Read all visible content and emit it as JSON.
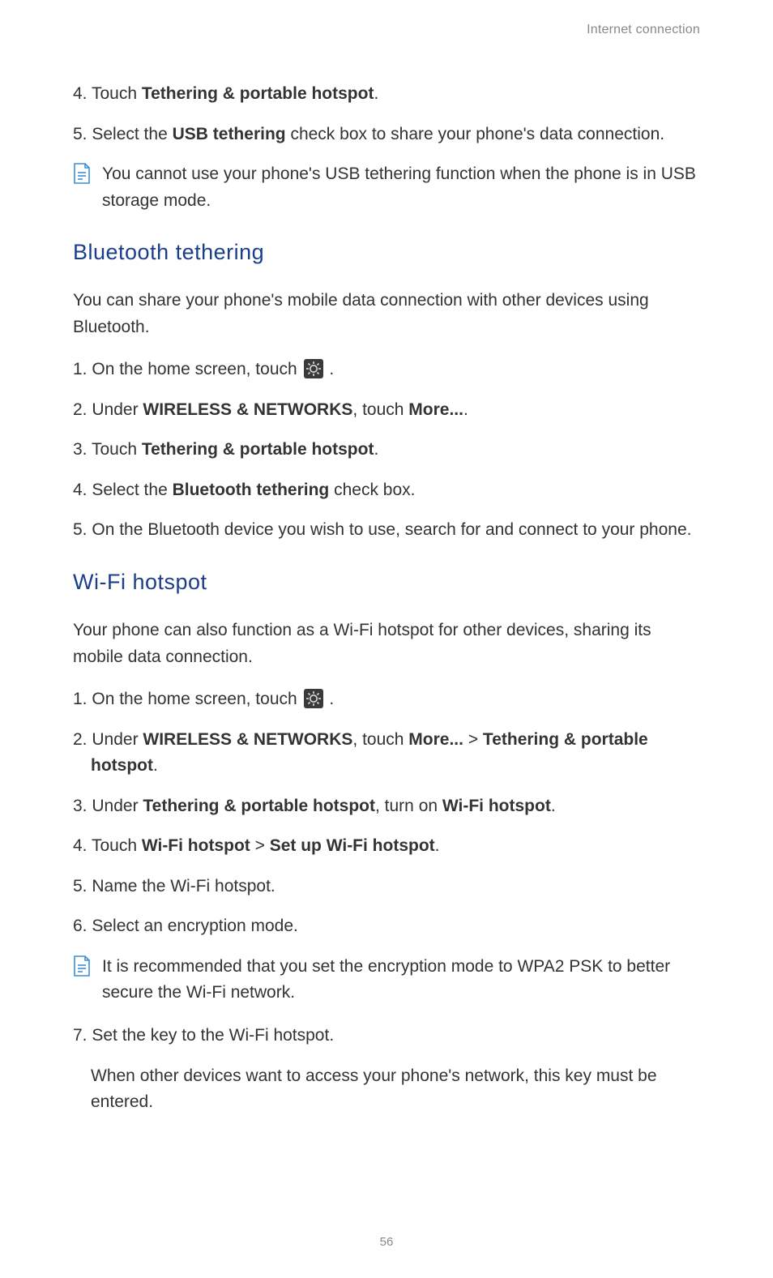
{
  "header": {
    "running": "Internet connection"
  },
  "top_steps": {
    "s4": {
      "num": "4. ",
      "pre": "Touch ",
      "bold": "Tethering & portable hotspot",
      "post": "."
    },
    "s5": {
      "num": "5. ",
      "pre": "Select the ",
      "bold": "USB tethering",
      "post": " check box to share your phone's data connection."
    }
  },
  "note1": "You cannot use your phone's USB tethering function when the phone is in USB storage mode.",
  "section1": {
    "heading": "Bluetooth  tethering",
    "intro": "You can share your phone's mobile data connection with other devices using Bluetooth.",
    "s1": {
      "num": "1. ",
      "pre": "On the home screen, touch ",
      "post": " ."
    },
    "s2": {
      "num": "2. ",
      "pre": "Under ",
      "bold1": "WIRELESS & NETWORKS",
      "mid": ", touch ",
      "bold2": "More...",
      "post": "."
    },
    "s3": {
      "num": "3. ",
      "pre": "Touch ",
      "bold": "Tethering & portable hotspot",
      "post": "."
    },
    "s4": {
      "num": "4. ",
      "pre": "Select the ",
      "bold": "Bluetooth tethering",
      "post": " check box."
    },
    "s5": {
      "num": "5. ",
      "text": "On the Bluetooth device you wish to use, search for and connect to your phone."
    }
  },
  "section2": {
    "heading": "Wi-Fi  hotspot",
    "intro": "Your phone can also function as a Wi-Fi hotspot for other devices, sharing its mobile data connection.",
    "s1": {
      "num": "1. ",
      "pre": "On the home screen, touch ",
      "post": " ."
    },
    "s2": {
      "num": "2. ",
      "pre": "Under ",
      "bold1": "WIRELESS & NETWORKS",
      "mid": ", touch ",
      "bold2": "More...",
      "mid2": " > ",
      "bold3": "Tethering & portable hotspot",
      "post": "."
    },
    "s3": {
      "num": "3. ",
      "pre": "Under ",
      "bold1": "Tethering & portable hotspot",
      "mid": ", turn on ",
      "bold2": "Wi-Fi hotspot",
      "post": "."
    },
    "s4": {
      "num": "4. ",
      "pre": "Touch ",
      "bold1": "Wi-Fi hotspot",
      "mid": " > ",
      "bold2": "Set up Wi-Fi hotspot",
      "post": "."
    },
    "s5": {
      "num": "5. ",
      "text": "Name the Wi-Fi hotspot."
    },
    "s6": {
      "num": "6. ",
      "text": "Select an encryption mode."
    },
    "note2": "It is recommended that you set the encryption mode to WPA2 PSK to better secure the Wi-Fi network.",
    "s7": {
      "num": "7. ",
      "text": "Set the key to the Wi-Fi hotspot."
    },
    "s7sub": "When other devices want to access your phone's network, this key must be entered."
  },
  "page_number": "56"
}
